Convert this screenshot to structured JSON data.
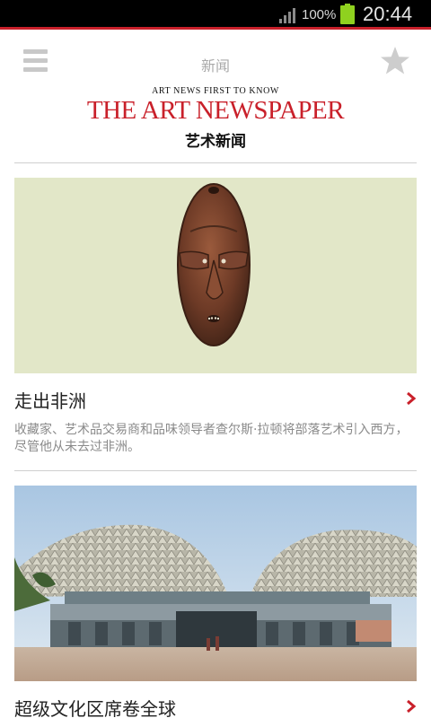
{
  "status_bar": {
    "battery_percent": "100%",
    "time": "20:44",
    "icons": [
      "signal-icon",
      "battery-icon"
    ]
  },
  "header": {
    "title": "新闻",
    "menu_icon": "menu-icon",
    "favorite_icon": "star-icon"
  },
  "logo": {
    "tagline": "ART NEWS  FIRST TO KNOW",
    "title": "THE ART NEWSPAPER",
    "subtitle_cn": "艺术新闻"
  },
  "articles": [
    {
      "title": "走出非洲",
      "summary": "收藏家、艺术品交易商和品味领导者查尔斯·拉顿将部落艺术引入西方，尽管他从未去过非洲。",
      "image": "tribal-mask-image"
    },
    {
      "title": "超级文化区席卷全球",
      "image": "esplanade-building-image"
    }
  ],
  "colors": {
    "brand_red": "#c9202a",
    "image_bg_green": "#e2e7c8",
    "summary_gray": "#8a8a8a"
  }
}
